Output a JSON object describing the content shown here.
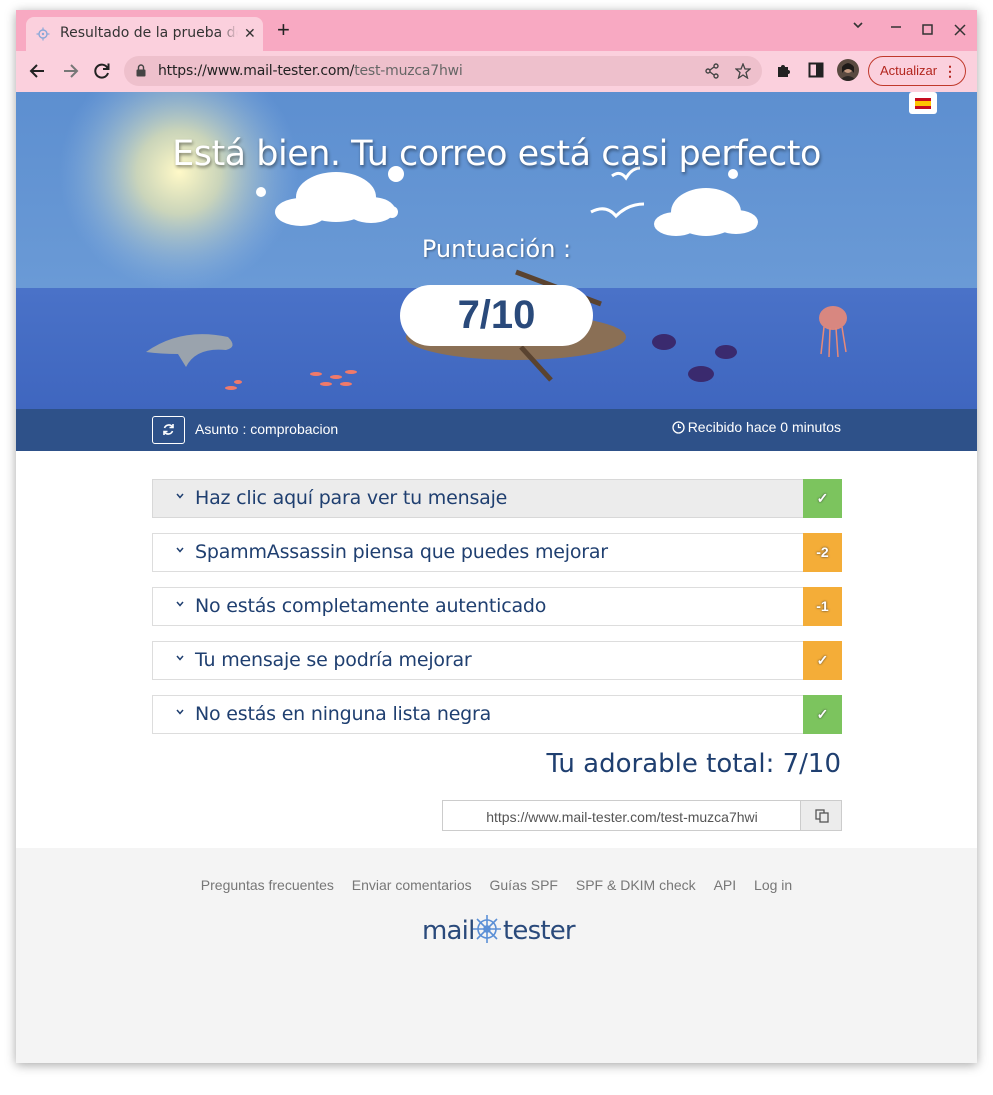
{
  "browser": {
    "tab_title": "Resultado de la prueba de spam",
    "tab_close": "✕",
    "new_tab": "+",
    "url_domain": "https://www.mail-tester.com/",
    "url_path": "test-muzca7hwi",
    "update_label": "Actualizar",
    "window_controls": {
      "chevron": "⌄",
      "minimize": "—",
      "maximize": "☐",
      "close": "✕"
    },
    "accent_color": "#f8a9c2"
  },
  "hero": {
    "title": "Está bien. Tu correo está casi perfecto",
    "score_label": "Puntuación :",
    "score_value": "7/10",
    "language_flag": "spain-flag-icon"
  },
  "subbar": {
    "subject": "Asunto : comprobacion",
    "received": "Recibido hace 0 minutos"
  },
  "results": {
    "rows": [
      {
        "label": "Haz clic aquí para ver tu mensaje",
        "badge": "✓",
        "status": "green"
      },
      {
        "label": "SpammAssassin piensa que puedes mejorar",
        "badge": "-2",
        "status": "orange"
      },
      {
        "label": "No estás completamente autenticado",
        "badge": "-1",
        "status": "orange"
      },
      {
        "label": "Tu mensaje se podría mejorar",
        "badge": "✓",
        "status": "orange"
      },
      {
        "label": "No estás en ninguna lista negra",
        "badge": "✓",
        "status": "green"
      }
    ],
    "total": "Tu adorable total: 7/10",
    "share_url": "https://www.mail-tester.com/test-muzca7hwi",
    "colors": {
      "green": "#7cc45e",
      "orange": "#f4ad38"
    }
  },
  "footer": {
    "links": [
      "Preguntas frecuentes",
      "Enviar comentarios",
      "Guías SPF",
      "SPF & DKIM check",
      "API",
      "Log in"
    ],
    "logo_left": "mail",
    "logo_right": "tester"
  }
}
